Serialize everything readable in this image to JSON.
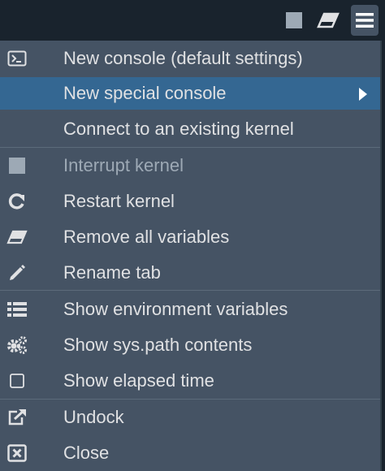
{
  "toolbar": {
    "icons": [
      "stop-icon",
      "eraser-icon",
      "hamburger-menu-icon"
    ]
  },
  "menu": {
    "items": [
      {
        "label": "New console (default settings)",
        "icon": "console-icon"
      },
      {
        "label": "New special console",
        "icon": "",
        "state": "highlighted",
        "submenu": true
      },
      {
        "label": "Connect to an existing kernel",
        "icon": ""
      },
      {
        "label": "Interrupt kernel",
        "icon": "stop-square-icon",
        "state": "disabled"
      },
      {
        "label": "Restart kernel",
        "icon": "restart-icon"
      },
      {
        "label": "Remove all variables",
        "icon": "eraser-icon"
      },
      {
        "label": "Rename tab",
        "icon": "pencil-icon"
      },
      {
        "label": "Show environment variables",
        "icon": "list-icon"
      },
      {
        "label": "Show sys.path contents",
        "icon": "gears-icon"
      },
      {
        "label": "Show elapsed time",
        "icon": "checkbox-icon"
      },
      {
        "label": "Undock",
        "icon": "external-link-icon"
      },
      {
        "label": "Close",
        "icon": "close-box-icon"
      }
    ]
  },
  "colors": {
    "background": "#19232d",
    "menu_background": "#455364",
    "highlight": "#346792",
    "text": "#e0e1e3",
    "disabled_text": "#9da9b5"
  }
}
